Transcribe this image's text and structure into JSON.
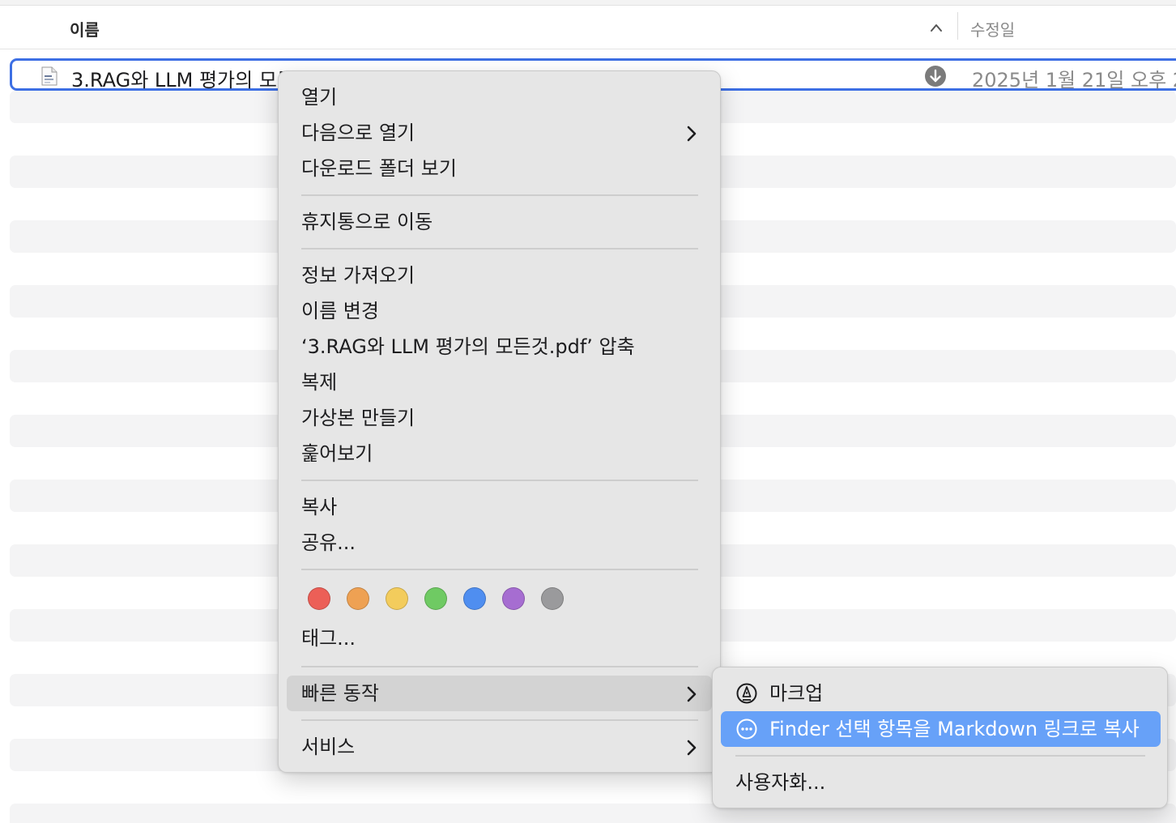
{
  "header": {
    "name_column": "이름",
    "modified_column": "수정일",
    "sort_icon": "chevron-up-icon"
  },
  "file": {
    "name": "3.RAG와 LLM 평가의 모든것.pdf",
    "modified": "2025년 1월 21일 오후 2",
    "icon": "pdf-document-icon",
    "status_icon": "download-arrow-icon"
  },
  "context_menu": {
    "open": "열기",
    "open_with": "다음으로 열기",
    "show_in_downloads": "다운로드 폴더 보기",
    "move_to_trash": "휴지통으로 이동",
    "get_info": "정보 가져오기",
    "rename": "이름 변경",
    "compress": "‘3.RAG와 LLM 평가의 모든것.pdf’ 압축",
    "duplicate": "복제",
    "make_alias": "가상본 만들기",
    "quick_look": "훑어보기",
    "copy": "복사",
    "share": "공유...",
    "tags": "태그...",
    "quick_actions": "빠른 동작",
    "services": "서비스",
    "tag_colors": [
      {
        "name": "red",
        "color": "#ec5f57"
      },
      {
        "name": "orange",
        "color": "#eea153"
      },
      {
        "name": "yellow",
        "color": "#f3cc5c"
      },
      {
        "name": "green",
        "color": "#6fca63"
      },
      {
        "name": "blue",
        "color": "#4f8ef0"
      },
      {
        "name": "purple",
        "color": "#a66dd1"
      },
      {
        "name": "gray",
        "color": "#9a9a9c"
      }
    ]
  },
  "quick_actions_submenu": {
    "markup": "마크업",
    "copy_markdown_link": "Finder 선택 항목을 Markdown 링크로 복사",
    "customize": "사용자화..."
  },
  "colors": {
    "selection_border": "#3d6fe4",
    "highlight_blue": "#67a1f8",
    "highlight_gray": "#d3d3d3"
  }
}
